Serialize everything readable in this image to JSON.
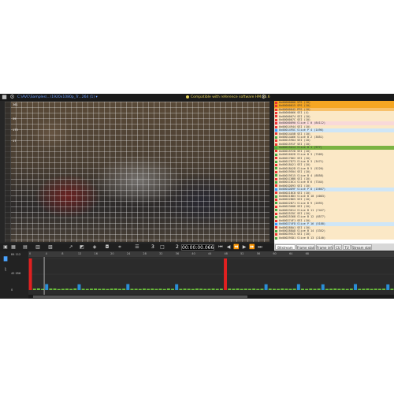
{
  "titlebar": {
    "file_name": "C:\\AVC\\Samples\\...\\1920x1080p_Tr...264 (1) ▾",
    "compat_text": "Compatible with reference software HM 16.6"
  },
  "toolbar": {
    "frame": "3",
    "page": "2",
    "time": "00:00:00.066"
  },
  "macroblock_labels": [
    "361",
    "39",
    "173",
    "17"
  ],
  "nal_units": [
    {
      "text": "0x00000000 VPS (10)",
      "bg": "#f5a623",
      "marker": "#e33"
    },
    {
      "text": "0x00000015 SPS (10)",
      "bg": "#f5a623",
      "marker": "#e33"
    },
    {
      "text": "0x00000042 PPS (10)",
      "bg": "#f7c06a",
      "marker": "#e33"
    },
    {
      "text": "0x00000066 SEI (4)",
      "bg": "#fbe8c6",
      "marker": "#e33"
    },
    {
      "text": "0x00000074 SEI (10)",
      "bg": "#fbe8c6",
      "marker": "#e33"
    },
    {
      "text": "0x0000007C SEI (10)",
      "bg": "#fbe8c6",
      "marker": "#e33"
    },
    {
      "text": "0x00000090 Slice I 0 (84112)",
      "bg": "#f9d9d9",
      "marker": "#e33"
    },
    {
      "text": "0x00014944 SEI (10)",
      "bg": "#fbe8c6",
      "marker": "#e33"
    },
    {
      "text": "0x0001495C Slice P 4 (1496)",
      "bg": "#cfe6f7",
      "marker": "#39f"
    },
    {
      "text": "0x00014A5B SEI (10)",
      "bg": "#fbe8c6",
      "marker": "#e33"
    },
    {
      "text": "0x00014A66 Slice B 2 (3851)",
      "bg": "#fbe8c6",
      "marker": "#4a4"
    },
    {
      "text": "0x00015904 SEI (10)",
      "bg": "#fbe8c6",
      "marker": "#e33"
    },
    {
      "text": "0x0001591F SEI (10)",
      "bg": "#fbe8c6",
      "marker": "#e33"
    },
    {
      "text": "0x00015A14 Slice B 1 (977)",
      "bg": "#7bb342",
      "marker": "#4a4"
    },
    {
      "text": "0x00015F2D SEI (10)",
      "bg": "#fbe8c6",
      "marker": "#e33"
    },
    {
      "text": "0x0001602D Slice B 3 (7509)",
      "bg": "#fbe8c6",
      "marker": "#4a4"
    },
    {
      "text": "0x00017D62 SEI (10)",
      "bg": "#fbe8c6",
      "marker": "#e33"
    },
    {
      "text": "0x00017D73 Slice B 3 (3471)",
      "bg": "#fbe8c6",
      "marker": "#4a4"
    },
    {
      "text": "0x00018A21 SEI (10)",
      "bg": "#fbe8c6",
      "marker": "#e33"
    },
    {
      "text": "0x00018A2D Slice B 5 (5220)",
      "bg": "#fbe8c6",
      "marker": "#4a4"
    },
    {
      "text": "0x00019E04 SEI (10)",
      "bg": "#fbe8c6",
      "marker": "#e33"
    },
    {
      "text": "0x00019E15 Slice B 4 (8858)",
      "bg": "#fbe8c6",
      "marker": "#4a4"
    },
    {
      "text": "0x0001C0B8 SEI (10)",
      "bg": "#fbe8c6",
      "marker": "#e33"
    },
    {
      "text": "0x0001C0C4 Slice B 6 (7344)",
      "bg": "#fbe8c6",
      "marker": "#4a4"
    },
    {
      "text": "0x0001DD93 SEI (10)",
      "bg": "#fbe8c6",
      "marker": "#e33"
    },
    {
      "text": "0x0001DD9F Slice P 8 (15667)",
      "bg": "#cfe6f7",
      "marker": "#39f"
    },
    {
      "text": "0x00021BC8 SEI (10)",
      "bg": "#fbe8c6",
      "marker": "#e33"
    },
    {
      "text": "0x00021BD3 Slice B 10 (4003)",
      "bg": "#fbe8c6",
      "marker": "#4a4"
    },
    {
      "text": "0x00022B65 SEI (10)",
      "bg": "#fbe8c6",
      "marker": "#e33"
    },
    {
      "text": "0x00022B71 Slice B 9 (2693)",
      "bg": "#fbe8c6",
      "marker": "#4a4"
    },
    {
      "text": "0x00023608 SEI (10)",
      "bg": "#fbe8c6",
      "marker": "#e33"
    },
    {
      "text": "0x00023614 Slice B 11 (7447)",
      "bg": "#fbe8c6",
      "marker": "#4a4"
    },
    {
      "text": "0x0002535C SEI (10)",
      "bg": "#fbe8c6",
      "marker": "#e33"
    },
    {
      "text": "0x00025368 Slice B 12 (8577)",
      "bg": "#fbe8c6",
      "marker": "#4a4"
    },
    {
      "text": "0x000274F1 SEI (10)",
      "bg": "#fbe8c6",
      "marker": "#e33"
    },
    {
      "text": "0x000274FD Slice P 16 (5188)",
      "bg": "#cfe6f7",
      "marker": "#39f"
    },
    {
      "text": "0x000288A1 SEI (10)",
      "bg": "#fbe8c6",
      "marker": "#e33"
    },
    {
      "text": "0x000288AD Slice B 14 (3352)",
      "bg": "#fbe8c6",
      "marker": "#4a4"
    },
    {
      "text": "0x000295C5 SEI (10)",
      "bg": "#fbe8c6",
      "marker": "#e33"
    },
    {
      "text": "0x000295D1 Slice B 13 (2140)",
      "bg": "#fbe8c6",
      "marker": "#4a4"
    }
  ],
  "panel_tabs": [
    {
      "label": "Bitstream",
      "active": true
    },
    {
      "label": "Frame stats",
      "active": false
    },
    {
      "label": "Frame info",
      "active": false
    },
    {
      "label": "CU",
      "active": false
    },
    {
      "label": "TU",
      "active": false
    },
    {
      "label": "Stream stats",
      "active": false
    }
  ],
  "timeline": {
    "y_labels": [
      "84 112",
      "42 056",
      "0"
    ],
    "ruler_ticks": [
      "0",
      "4",
      "8",
      "12",
      "16",
      "20",
      "24",
      "28",
      "32",
      "36",
      "40",
      "44",
      "48",
      "52",
      "56",
      "60",
      "64",
      "68"
    ],
    "frame_bars": {
      "colors": {
        "I": "#e02020",
        "P": "#2a8fd6",
        "B": "#6abf3a"
      },
      "types": [
        "I",
        "B",
        "B",
        "B",
        "P",
        "B",
        "B",
        "B",
        "B",
        "B",
        "B",
        "B",
        "P",
        "B",
        "B",
        "B",
        "B",
        "B",
        "B",
        "B",
        "B",
        "B",
        "B",
        "B",
        "P",
        "B",
        "B",
        "B",
        "B",
        "B",
        "B",
        "B",
        "B",
        "B",
        "B",
        "B",
        "P",
        "B",
        "B",
        "B",
        "B",
        "B",
        "B",
        "B",
        "B",
        "B",
        "B",
        "B",
        "I",
        "B",
        "B",
        "B",
        "B",
        "B",
        "B",
        "B",
        "B",
        "B",
        "P",
        "B",
        "B",
        "B",
        "B",
        "B",
        "B",
        "B",
        "P",
        "B",
        "B",
        "B",
        "B",
        "B",
        "P",
        "B",
        "B",
        "B",
        "B",
        "B",
        "B",
        "B",
        "P",
        "B",
        "B",
        "B",
        "B",
        "B",
        "B",
        "B",
        "P",
        "B"
      ],
      "values": [
        84112,
        3500,
        4200,
        3000,
        15667,
        3800,
        3900,
        2700,
        3200,
        3600,
        3000,
        4100,
        15200,
        3300,
        2900,
        3500,
        3700,
        3100,
        3400,
        2800,
        3600,
        3900,
        3000,
        3500,
        15800,
        3200,
        3300,
        2900,
        3700,
        3100,
        3600,
        3000,
        3400,
        2800,
        3900,
        3200,
        15400,
        3100,
        3600,
        3300,
        2900,
        3800,
        3500,
        3000,
        3200,
        3700,
        3100,
        3400,
        84112,
        3600,
        3300,
        3800,
        3000,
        3500,
        3100,
        3700,
        2900,
        3400,
        15300,
        3600,
        3200,
        3000,
        3800,
        3400,
        3100,
        3500,
        15500,
        3300,
        2900,
        3700,
        3200,
        3600,
        15100,
        3000,
        3400,
        3800,
        3200,
        3500,
        2900,
        3600,
        15700,
        3100,
        3300,
        3800,
        3000,
        3500,
        3200,
        3600,
        14900,
        3400
      ]
    }
  }
}
